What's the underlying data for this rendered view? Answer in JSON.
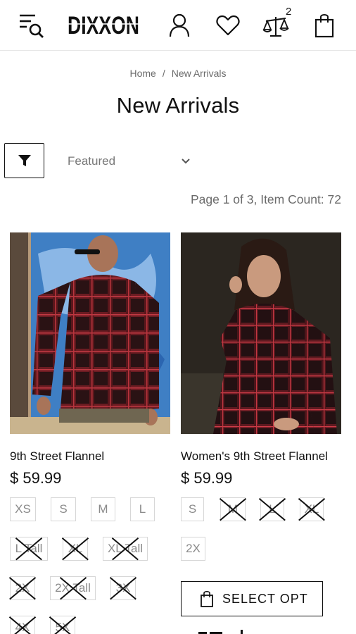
{
  "header": {
    "logo_text": "DIXXON",
    "compare_count": "2",
    "icons": {
      "menu": "menu-search-icon",
      "account": "user-icon",
      "wishlist": "heart-icon",
      "compare": "scales-icon",
      "bag": "shopping-bag-icon"
    }
  },
  "breadcrumb": {
    "home": "Home",
    "separator": "/",
    "current": "New Arrivals"
  },
  "page_title": "New Arrivals",
  "toolbar": {
    "filter_icon": "filter-icon",
    "sort_selected": "Featured"
  },
  "pagination": {
    "summary": "Page 1 of 3, Item Count: 72"
  },
  "products": [
    {
      "name": "9th Street Flannel",
      "price": "$ 59.99",
      "sizes": [
        {
          "label": "XS",
          "available": true
        },
        {
          "label": "S",
          "available": true
        },
        {
          "label": "M",
          "available": true
        },
        {
          "label": "L",
          "available": true
        },
        {
          "label": "L Tall",
          "available": false
        },
        {
          "label": "XL",
          "available": false
        },
        {
          "label": "XL Tall",
          "available": false
        },
        {
          "label": "2X",
          "available": false
        },
        {
          "label": "2X Tall",
          "available": false
        },
        {
          "label": "3X",
          "available": false
        },
        {
          "label": "4X",
          "available": false
        },
        {
          "label": "5X",
          "available": false
        }
      ]
    },
    {
      "name": "Women's 9th Street Flannel",
      "price": "$ 59.99",
      "sizes": [
        {
          "label": "S",
          "available": true
        },
        {
          "label": "M",
          "available": false
        },
        {
          "label": "L",
          "available": false
        },
        {
          "label": "XL",
          "available": false
        },
        {
          "label": "2X",
          "available": true
        }
      ],
      "select_button": "SELECT OPT"
    }
  ],
  "colors": {
    "text": "#111111",
    "muted": "#6b6b6b",
    "swatch_border": "#d7d7d7",
    "flannel_red": "#7a1e24"
  }
}
